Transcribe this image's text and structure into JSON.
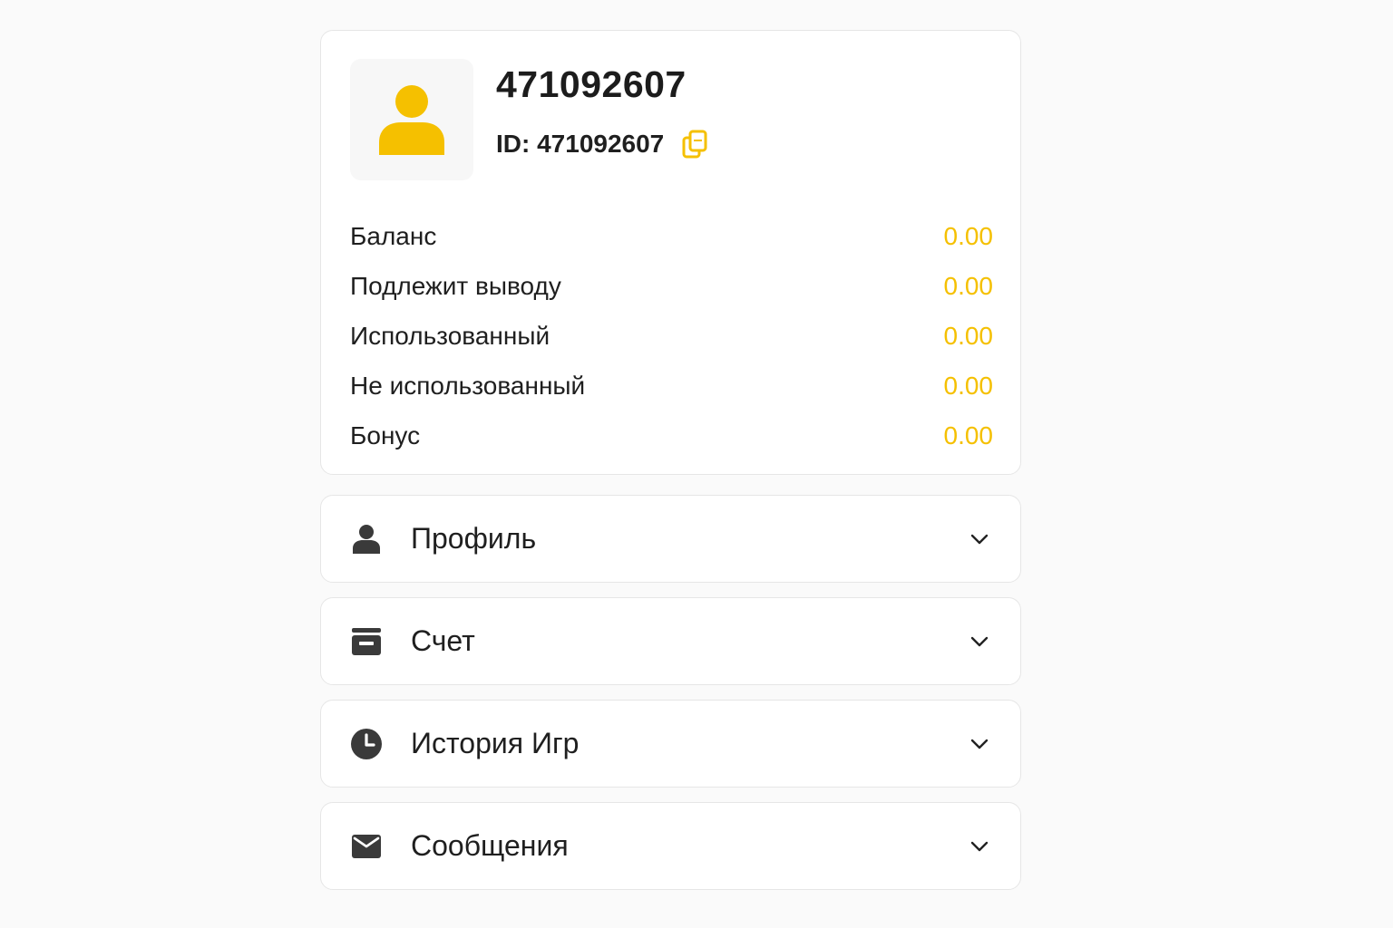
{
  "profile": {
    "username": "471092607",
    "id_label": "ID: 471092607",
    "accent_color": "#f5c000"
  },
  "balances": [
    {
      "label": "Баланс",
      "value": "0.00"
    },
    {
      "label": "Подлежит выводу",
      "value": "0.00"
    },
    {
      "label": "Использованный",
      "value": "0.00"
    },
    {
      "label": "Не использованный",
      "value": "0.00"
    },
    {
      "label": "Бонус",
      "value": "0.00"
    }
  ],
  "menu": [
    {
      "label": "Профиль",
      "icon": "user-icon"
    },
    {
      "label": "Счет",
      "icon": "wallet-icon"
    },
    {
      "label": "История Игр",
      "icon": "clock-icon"
    },
    {
      "label": "Сообщения",
      "icon": "envelope-icon"
    }
  ]
}
